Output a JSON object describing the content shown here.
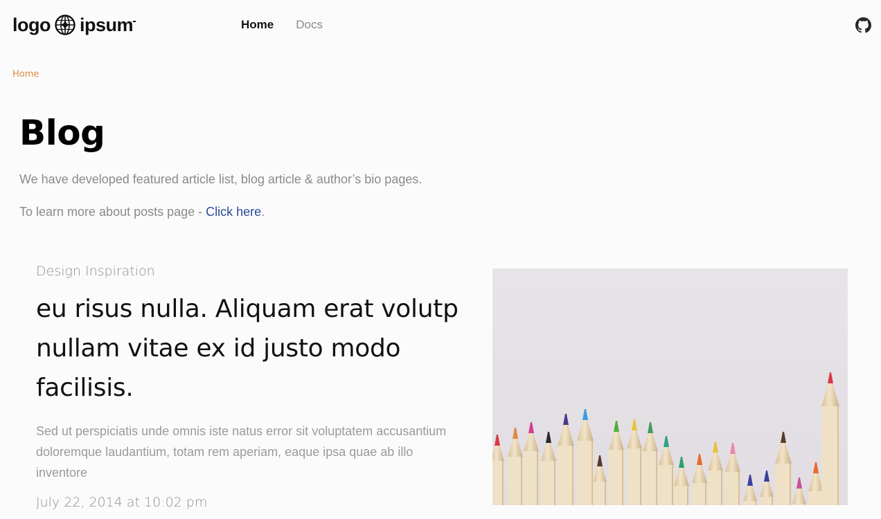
{
  "header": {
    "logo_text_left": "logo",
    "logo_text_right": "ipsum",
    "nav": [
      {
        "label": "Home",
        "active": true
      },
      {
        "label": "Docs",
        "active": false
      }
    ],
    "github_icon": "github-icon"
  },
  "breadcrumb": {
    "home_label": "Home"
  },
  "page": {
    "title": "Blog",
    "intro": "We have developed featured article list, blog article & author’s bio pages.",
    "learn_prefix": "To learn more about posts page - ",
    "learn_link": "Click here",
    "learn_suffix": "."
  },
  "featured_post": {
    "category": "Design Inspiration",
    "title": "eu risus nulla. Aliquam erat volutp nullam vitae ex id justo modo facilisis.",
    "excerpt": "Sed ut perspiciatis unde omnis iste natus error sit voluptatem accusantium doloremque laudantium, totam rem aperiam, eaque ipsa quae ab illo inventore",
    "date": "July 22, 2014 at 10:02 pm",
    "image": "colored-pencils-photo"
  },
  "colors": {
    "accent_orange": "#e0883f",
    "link_blue": "#2c4a96",
    "muted_text": "#8a8a8a"
  }
}
